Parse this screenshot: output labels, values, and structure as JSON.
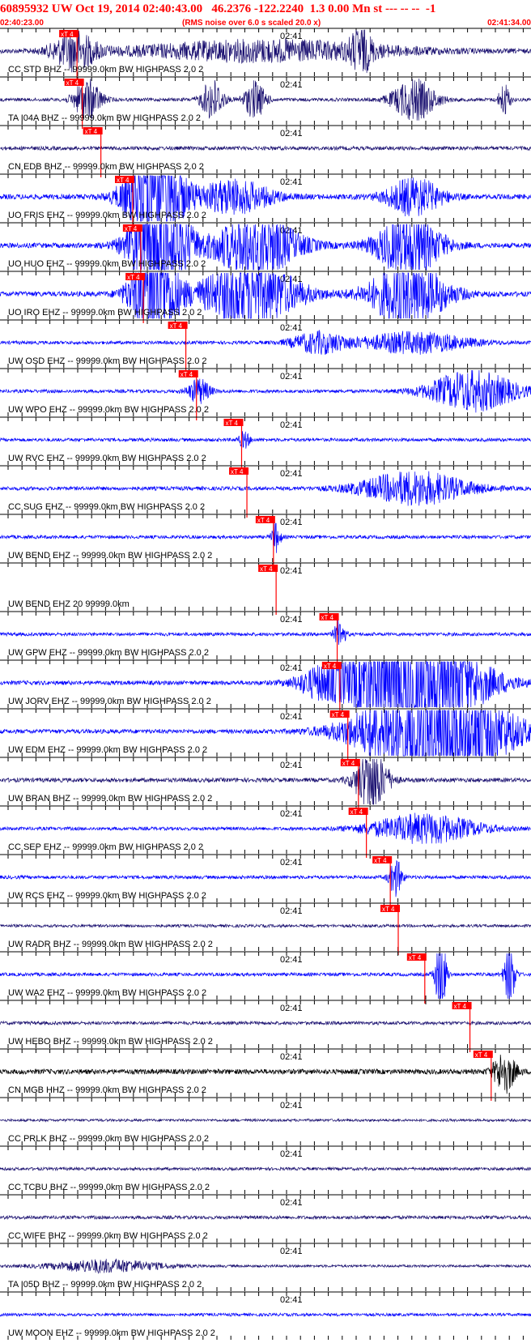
{
  "header": {
    "title": "60895932 UW Oct 19, 2014 02:40:43.00   46.2376 -122.2240  1.3 0.00 Mn st --- -- --  -1",
    "start_time": "02:40:23.00",
    "rms_note": "(RMS noise over 6.0 s scaled 20.0 x)",
    "end_time": "02:41:34.00"
  },
  "minute_label": "02:41",
  "pick_label": "xT 4",
  "colors": {
    "header_red": "#ff0000",
    "pick_red": "#ff0000",
    "trace_blue": "#0000ff",
    "trace_navy": "#1a1070",
    "trace_black": "#000000",
    "tick_black": "#000000"
  },
  "traces": [
    {
      "label": "CC STD BHZ -- 99999.0km BW  HIGHPASS  2.0  2",
      "color": "navy",
      "pick": 0.145,
      "amp": 0.1,
      "bursts": [
        [
          0.14,
          0.04,
          0.9
        ],
        [
          0.5,
          0.25,
          0.5
        ],
        [
          0.68,
          0.02,
          0.9
        ]
      ]
    },
    {
      "label": "TA I04A BHZ -- 99999.0km BW  HIGHPASS  2.0  2",
      "color": "navy",
      "pick": 0.155,
      "amp": 0.08,
      "bursts": [
        [
          0.165,
          0.025,
          1.0
        ],
        [
          0.4,
          0.02,
          1.0
        ],
        [
          0.48,
          0.02,
          0.9
        ],
        [
          0.78,
          0.04,
          1.0
        ],
        [
          0.95,
          0.01,
          0.8
        ]
      ]
    },
    {
      "label": "CN EDB BHZ -- 99999.0km BW  HIGHPASS  2.0  2",
      "color": "navy",
      "pick": 0.19,
      "amp": 0.09,
      "bursts": []
    },
    {
      "label": "UO FRIS EHZ -- 99999.0km BW  HIGHPASS  2.0  2",
      "color": "blue",
      "pick": 0.25,
      "amp": 0.12,
      "bursts": [
        [
          0.29,
          0.05,
          3.0
        ],
        [
          0.44,
          0.07,
          0.8
        ],
        [
          0.78,
          0.05,
          0.9
        ]
      ]
    },
    {
      "label": "UO HUO EHZ -- 99999.0km BW  HIGHPASS  2.0  2",
      "color": "blue",
      "pick": 0.265,
      "amp": 0.12,
      "bursts": [
        [
          0.3,
          0.05,
          3.0
        ],
        [
          0.48,
          0.08,
          1.5
        ],
        [
          0.77,
          0.06,
          1.5
        ]
      ]
    },
    {
      "label": "UO IRO EHZ -- 99999.0km BW  HIGHPASS  2.0  2",
      "color": "blue",
      "pick": 0.27,
      "amp": 0.12,
      "bursts": [
        [
          0.29,
          0.04,
          3.0
        ],
        [
          0.47,
          0.09,
          1.6
        ],
        [
          0.77,
          0.07,
          1.6
        ]
      ]
    },
    {
      "label": "UW OSD EHZ -- 99999.0km BW  HIGHPASS  2.0  2",
      "color": "blue",
      "pick": 0.35,
      "amp": 0.08,
      "bursts": [
        [
          0.6,
          0.05,
          0.5
        ],
        [
          0.78,
          0.1,
          0.5
        ]
      ]
    },
    {
      "label": "UW WPO EHZ -- 99999.0km BW  HIGHPASS  2.0  2",
      "color": "blue",
      "pick": 0.37,
      "amp": 0.08,
      "bursts": [
        [
          0.375,
          0.02,
          0.6
        ],
        [
          0.89,
          0.08,
          1.0
        ]
      ]
    },
    {
      "label": "UW RVC EHZ -- 99999.0km BW  HIGHPASS  2.0  2",
      "color": "blue",
      "pick": 0.455,
      "amp": 0.08,
      "bursts": [
        [
          0.46,
          0.01,
          0.4
        ]
      ]
    },
    {
      "label": "CC SUG EHZ -- 99999.0km BW  HIGHPASS  2.0  2",
      "color": "blue",
      "pick": 0.465,
      "amp": 0.09,
      "bursts": [
        [
          0.78,
          0.1,
          0.8
        ]
      ]
    },
    {
      "label": "UW BEND EHZ -- 99999.0km BW  HIGHPASS  2.0  2",
      "color": "blue",
      "pick": 0.515,
      "amp": 0.08,
      "bursts": [
        [
          0.52,
          0.008,
          0.7
        ]
      ]
    },
    {
      "label": "UW BEND EHZ 20 99999.0km",
      "color": "none",
      "pick": 0.52,
      "amp": 0,
      "bursts": []
    },
    {
      "label": "UW GPW EHZ -- 99999.0km BW  HIGHPASS  2.0  2",
      "color": "blue",
      "pick": 0.635,
      "amp": 0.08,
      "bursts": [
        [
          0.64,
          0.01,
          0.7
        ]
      ]
    },
    {
      "label": "UW JORV EHZ -- 99999.0km BW  HIGHPASS  2.0  2",
      "color": "blue",
      "pick": 0.64,
      "amp": 0.1,
      "bursts": [
        [
          0.6,
          0.04,
          0.5
        ],
        [
          0.78,
          0.12,
          3.0
        ]
      ]
    },
    {
      "label": "UW EDM EHZ -- 99999.0km BW  HIGHPASS  2.0  2",
      "color": "blue",
      "pick": 0.655,
      "amp": 0.1,
      "bursts": [
        [
          0.82,
          0.13,
          3.0
        ]
      ]
    },
    {
      "label": "UW BRAN BHZ -- 99999.0km BW  HIGHPASS  2.0  2",
      "color": "navy",
      "pick": 0.675,
      "amp": 0.1,
      "bursts": [
        [
          0.7,
          0.03,
          1.5
        ]
      ]
    },
    {
      "label": "CC SEP EHZ -- 99999.0km BW  HIGHPASS  2.0  2",
      "color": "blue",
      "pick": 0.69,
      "amp": 0.08,
      "bursts": [
        [
          0.8,
          0.1,
          0.7
        ]
      ]
    },
    {
      "label": "UW RCS EHZ -- 99999.0km BW  HIGHPASS  2.0  2",
      "color": "blue",
      "pick": 0.735,
      "amp": 0.08,
      "bursts": [
        [
          0.745,
          0.012,
          0.9
        ]
      ]
    },
    {
      "label": "UW RADR BHZ -- 99999.0km BW  HIGHPASS  2.0  2",
      "color": "navy",
      "pick": 0.75,
      "amp": 0.07,
      "bursts": []
    },
    {
      "label": "UW WA2 EHZ -- 99999.0km BW  HIGHPASS  2.0  2",
      "color": "blue",
      "pick": 0.8,
      "amp": 0.08,
      "bursts": [
        [
          0.83,
          0.01,
          2.0
        ],
        [
          0.96,
          0.01,
          1.5
        ]
      ]
    },
    {
      "label": "UW HEBO BHZ -- 99999.0km BW  HIGHPASS  2.0  2",
      "color": "navy",
      "pick": 0.885,
      "amp": 0.08,
      "bursts": []
    },
    {
      "label": "CN MGB HHZ -- 99999.0km BW  HIGHPASS  2.0  2",
      "color": "black",
      "pick": 0.925,
      "amp": 0.12,
      "bursts": [
        [
          0.95,
          0.02,
          1.0
        ]
      ]
    },
    {
      "label": "CC PRLK BHZ -- 99999.0km BW  HIGHPASS  2.0  2",
      "color": "navy",
      "pick": null,
      "amp": 0.06,
      "bursts": []
    },
    {
      "label": "CC TCBU BHZ -- 99999.0km BW  HIGHPASS  2.0  2",
      "color": "navy",
      "pick": null,
      "amp": 0.07,
      "bursts": []
    },
    {
      "label": "CC WIFE BHZ -- 99999.0km BW  HIGHPASS  2.0  2",
      "color": "navy",
      "pick": null,
      "amp": 0.08,
      "bursts": []
    },
    {
      "label": "TA I05D BHZ -- 99999.0km BW  HIGHPASS  2.0  2",
      "color": "navy",
      "pick": null,
      "amp": 0.06,
      "bursts": [
        [
          0.2,
          0.1,
          0.3
        ]
      ]
    },
    {
      "label": "UW MOON EHZ -- 99999.0km BW  HIGHPASS  2.0  2",
      "color": "blue",
      "pick": null,
      "amp": 0.07,
      "bursts": []
    }
  ]
}
